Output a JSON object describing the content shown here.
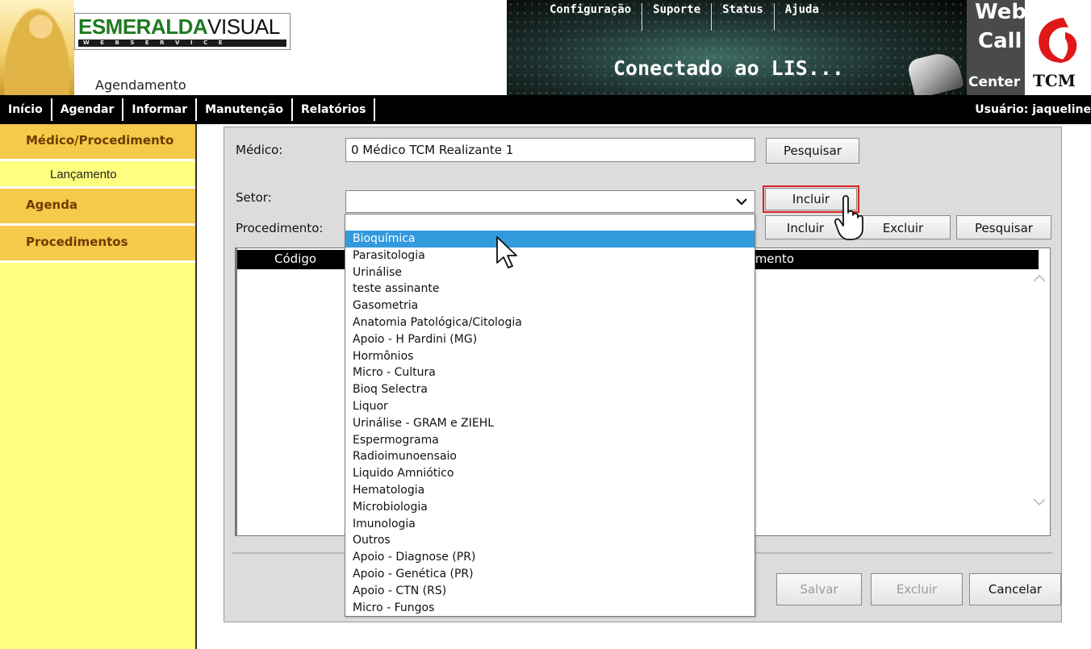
{
  "header": {
    "logo_brand_bold": "ESMERALDA",
    "logo_brand_light": "VISUAL",
    "logo_subtitle": "WEBSERVICE",
    "module": "Agendamento",
    "top_links": [
      "Configuração",
      "Suporte",
      "Status",
      "Ajuda"
    ],
    "status_text": "Conectado ao LIS...",
    "webcall_line1": "Web",
    "webcall_line2": "Call",
    "webcall_line3": "Center",
    "tcm_text": "TCM"
  },
  "nav": {
    "items": [
      "Início",
      "Agendar",
      "Informar",
      "Manutenção",
      "Relatórios"
    ],
    "user": "Usuário: jaqueline"
  },
  "sidebar": {
    "section_medico": "Médico/Procedimento",
    "sub_lancamento": "Lançamento",
    "section_agenda": "Agenda",
    "section_procedimentos": "Procedimentos"
  },
  "form": {
    "medico_label": "Médico:",
    "medico_value": "0 Médico TCM Realizante 1",
    "pesquisar_label": "Pesquisar",
    "setor_label": "Setor:",
    "setor_value": "",
    "incluir_label": "Incluir",
    "procedimento_label": "Procedimento:",
    "proc_incluir_label": "Incluir",
    "proc_excluir_label": "Excluir",
    "proc_pesquisar_label": "Pesquisar"
  },
  "table": {
    "col_codigo": "Código",
    "col_procedimento_partial": "dimento"
  },
  "footer": {
    "salvar_label": "Salvar",
    "excluir_label": "Excluir",
    "cancelar_label": "Cancelar"
  },
  "setor_options": [
    "Bioquímica",
    "Parasitologia",
    "Urinálise",
    "teste assinante",
    "Gasometria",
    "Anatomia Patológica/Citologia",
    "Apoio - H Pardini (MG)",
    "Hormônios",
    "Micro - Cultura",
    "Bioq Selectra",
    "Liquor",
    "Urinálise - GRAM e ZIEHL",
    "Espermograma",
    "Radioimunoensaio",
    "Liquido Amniótico",
    "Hematologia",
    "Microbiologia",
    "Imunologia",
    "Outros",
    "Apoio - Diagnose (PR)",
    "Apoio - Genética (PR)",
    "Apoio - CTN (RS)",
    "Micro - Fungos"
  ],
  "setor_highlighted": "Bioquímica",
  "colors": {
    "sidebar_bg": "#ffff80",
    "sidebar_section": "#f5c94a",
    "section_text": "#6b3d00",
    "highlight": "#3399dd",
    "focus_outline": "#dd2222"
  }
}
